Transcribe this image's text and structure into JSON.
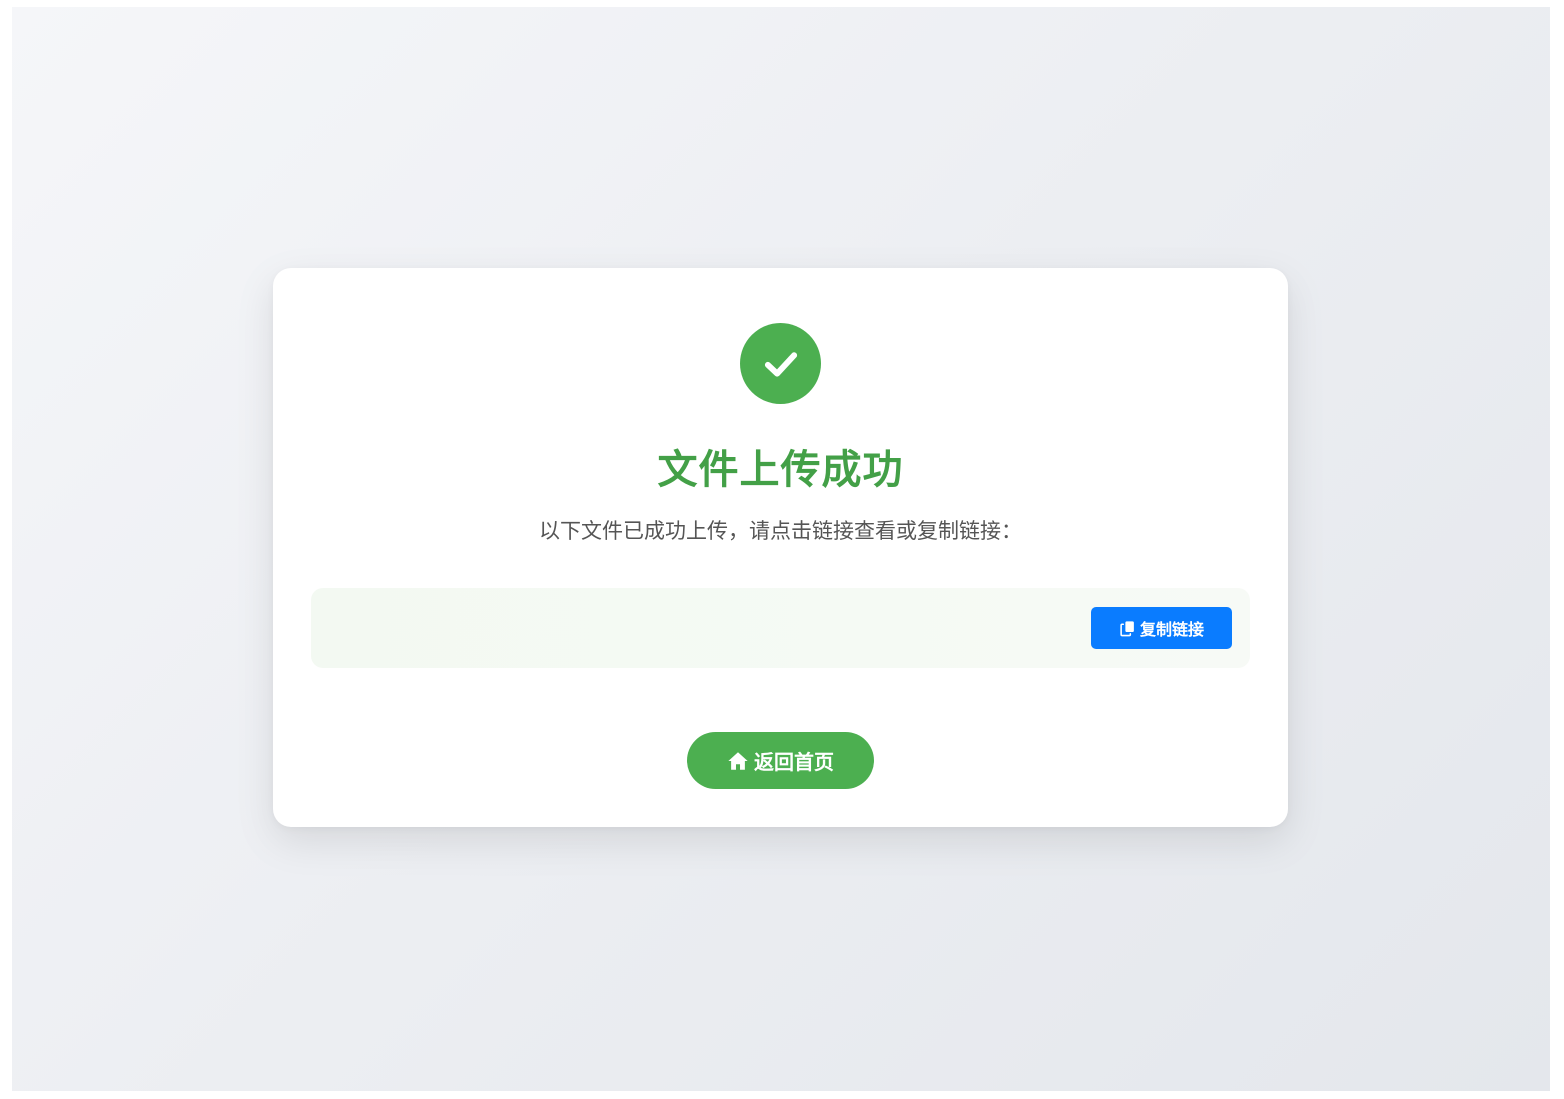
{
  "page": {
    "background_colors": [
      "#f5f6f9",
      "#e4e7ec"
    ]
  },
  "card": {
    "icon": "check-circle-icon",
    "icon_color": "#4caf50",
    "title": "文件上传成功",
    "title_color": "#43a047",
    "subtitle": "以下文件已成功上传，请点击链接查看或复制链接："
  },
  "link_box": {
    "link_text": "",
    "copy_button": {
      "icon": "copy-icon",
      "label": "复制链接",
      "color": "#0a7cff"
    }
  },
  "home_button": {
    "icon": "home-icon",
    "label": "返回首页",
    "color": "#4caf50"
  }
}
